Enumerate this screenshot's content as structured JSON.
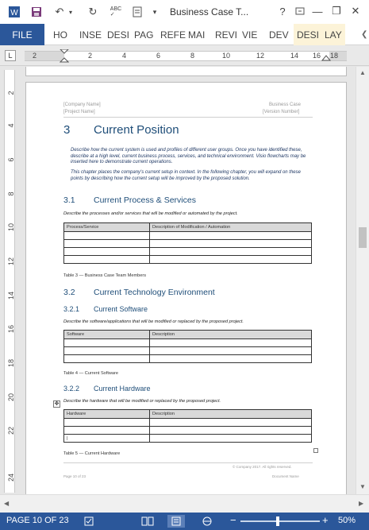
{
  "titlebar": {
    "title": "Business Case T...",
    "help": "?",
    "minimize": "—",
    "restore": "❐",
    "close": "✕"
  },
  "ribbon": {
    "file": "FILE",
    "tabs": [
      "HO",
      "INSE",
      "DESI",
      "PAG",
      "REFE",
      "MAI",
      "REVI",
      "VIE",
      "DEV",
      "DESI",
      "LAY"
    ]
  },
  "ruler": {
    "numbers": [
      "2",
      "2",
      "4",
      "6",
      "8",
      "10",
      "12",
      "14",
      "16",
      "18"
    ]
  },
  "vruler": {
    "numbers": [
      "2",
      "4",
      "6",
      "8",
      "10",
      "12",
      "14",
      "16",
      "18",
      "20",
      "22",
      "24"
    ]
  },
  "document": {
    "header_left_1": "[Company Name]",
    "header_left_2": "[Project Name]",
    "header_right_1": "Business Case",
    "header_right_2": "[Version Number]",
    "h1_number": "3",
    "h1_title": "Current Position",
    "intro_1": "Describe how the current system is used and profiles of different user groups. Once you have identified these, describe at a high level, current business process, services, and technical environment. Visio flowcharts may be inserted here to demonstrate current operations.",
    "intro_2": "This chapter places the company's current setup in context. In the following chapter, you will expand on these points by describing how the current setup will be improved by the proposed solution.",
    "s31_number": "3.1",
    "s31_title": "Current Process & Services",
    "s31_desc": "Describe the processes and/or services that will be modified or automated by the project.",
    "t3_headers": [
      "Process/Service",
      "Description of Modification / Automation"
    ],
    "t3_caption": "Table 3 — Business Case Team Members",
    "s32_number": "3.2",
    "s32_title": "Current Technology Environment",
    "s321_number": "3.2.1",
    "s321_title": "Current Software",
    "s321_desc": "Describe the software/applications that will be modified or replaced by the proposed project.",
    "t4_headers": [
      "Software",
      "Description"
    ],
    "t4_caption": "Table 4 — Current Software",
    "s322_number": "3.2.2",
    "s322_title": "Current Hardware",
    "s322_desc": "Describe the hardware that will be modified or replaced by the proposed project.",
    "t5_headers": [
      "Hardware",
      "Description"
    ],
    "t5_caption": "Table 5 — Current Hardware",
    "footer_right": "© Company 2017. All rights reserved.",
    "footer_left": "Page 10 of 23",
    "footer_doc": "Document Name"
  },
  "status": {
    "page_count": "PAGE 10 OF 23",
    "zoom_minus": "−",
    "zoom_plus": "+",
    "zoom_level": "50%",
    "zoom_fraction": 0.5
  }
}
